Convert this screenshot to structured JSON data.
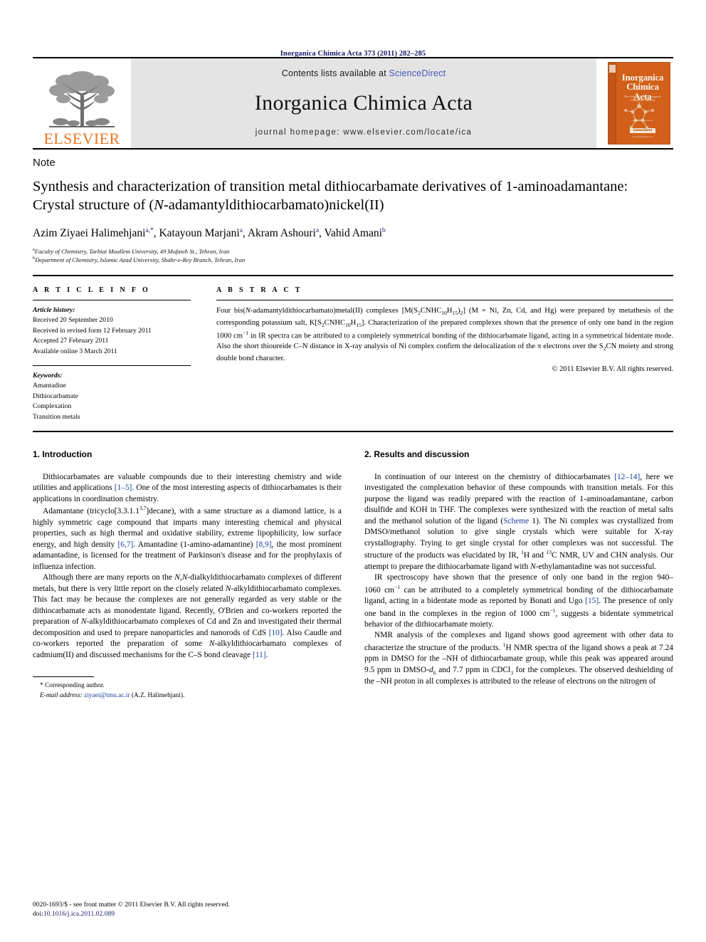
{
  "running_head": "Inorganica Chimica Acta 373 (2011) 282–285",
  "masthead": {
    "publisher_name": "ELSEVIER",
    "contents_prefix": "Contents lists available at ",
    "contents_link": "ScienceDirect",
    "journal_name": "Inorganica Chimica Acta",
    "homepage": "journal homepage: www.elsevier.com/locate/ica",
    "cover": {
      "title_line1": "Inorganica",
      "title_line2": "Chimica Acta",
      "subtitle": "The International Inorganic Chemistry Journal",
      "footer_label": "available online at",
      "footer_brand": "ScienceDirect",
      "footer_url": "www.sciencedirect.com"
    }
  },
  "article": {
    "type_label": "Note",
    "title_part1": "Synthesis and characterization of transition metal dithiocarbamate derivatives of 1-aminoadamantane: Crystal structure of (",
    "title_italic": "N",
    "title_part2": "-adamantyldithiocarbamato)nickel(II)",
    "authors": [
      {
        "name": "Azim Ziyaei Halimehjani",
        "marks": "a,*"
      },
      {
        "name": "Katayoun Marjani",
        "marks": "a"
      },
      {
        "name": "Akram Ashouri",
        "marks": "a"
      },
      {
        "name": "Vahid Amani",
        "marks": "b"
      }
    ],
    "affiliations": [
      {
        "mark": "a",
        "text": "Faculty of Chemistry, Tarbiat Moallem University, 49 Mofateh St., Tehran, Iran"
      },
      {
        "mark": "b",
        "text": "Department of Chemistry, Islamic Azad University, Shahr-e-Rey Branch, Tehran, Iran"
      }
    ]
  },
  "article_info": {
    "heading": "A R T I C L E    I N F O",
    "history_label": "Article history:",
    "history": [
      "Received 20 September 2010",
      "Received in revised form 12 February 2011",
      "Accepted 27 February 2011",
      "Available online 3 March 2011"
    ],
    "keywords_label": "Keywords:",
    "keywords": [
      "Amantadine",
      "Dithiocarbamate",
      "Complexation",
      "Transition metals"
    ]
  },
  "abstract": {
    "heading": "A B S T R A C T",
    "copyright": "© 2011 Elsevier B.V. All rights reserved."
  },
  "sections": {
    "introduction": {
      "heading": "1. Introduction",
      "paragraphs": [
        "Dithiocarbamates are valuable compounds due to their interesting chemistry and wide utilities and applications [1–5]. One of the most interesting aspects of dithiocarbamates is their applications in coordination chemistry.",
        "Adamantane (tricyclo[3.3.1.13,7]decane), with a same structure as a diamond lattice, is a highly symmetric cage compound that imparts many interesting chemical and physical properties, such as high thermal and oxidative stability, extreme lipophilicity, low surface energy, and high density [6,7]. Amantadine (1-amino-adamantine) [8,9], the most prominent adamantadine, is licensed for the treatment of Parkinson's disease and for the prophylaxis of influenza infection.",
        "Although there are many reports on the N,N-dialkyldithiocarbamato complexes of different metals, but there is very little report on the closely related N-alkyldithiocarbamato complexes. This fact may be because the complexes are not generally regarded as very stable or the dithiocarbamate acts as monodentate ligand. Recently, O'Brien and co-workers reported the preparation of N-alkyldithiocarbamato complexes of Cd and Zn and investigated their thermal decomposition and used to prepare nanoparticles and nanorods of CdS [10]. Also Caudle and co-workers reported the preparation of some N-alkyldithiocarbamato complexes of cadmium(II) and discussed mechanisms for the C–S bond cleavage [11]."
      ]
    },
    "results": {
      "heading": "2. Results and discussion"
    }
  },
  "footnote": {
    "corresponding": "* Corresponding author.",
    "email_label": "E-mail address:",
    "email": "ziyaei@tmu.ac.ir",
    "email_owner": "(A.Z. Halimehjani)."
  },
  "issn": {
    "line1": "0020-1693/$ - see front matter © 2011 Elsevier B.V. All rights reserved.",
    "doi_label": "doi:",
    "doi_value": "10.1016/j.ica.2011.02.089"
  },
  "colors": {
    "link_blue": "#1a3f9e",
    "navy": "#1a1a6e",
    "elsevier_orange": "#E87722",
    "cover_orange": "#d2601a",
    "panel_gray": "#e4e4e4"
  }
}
